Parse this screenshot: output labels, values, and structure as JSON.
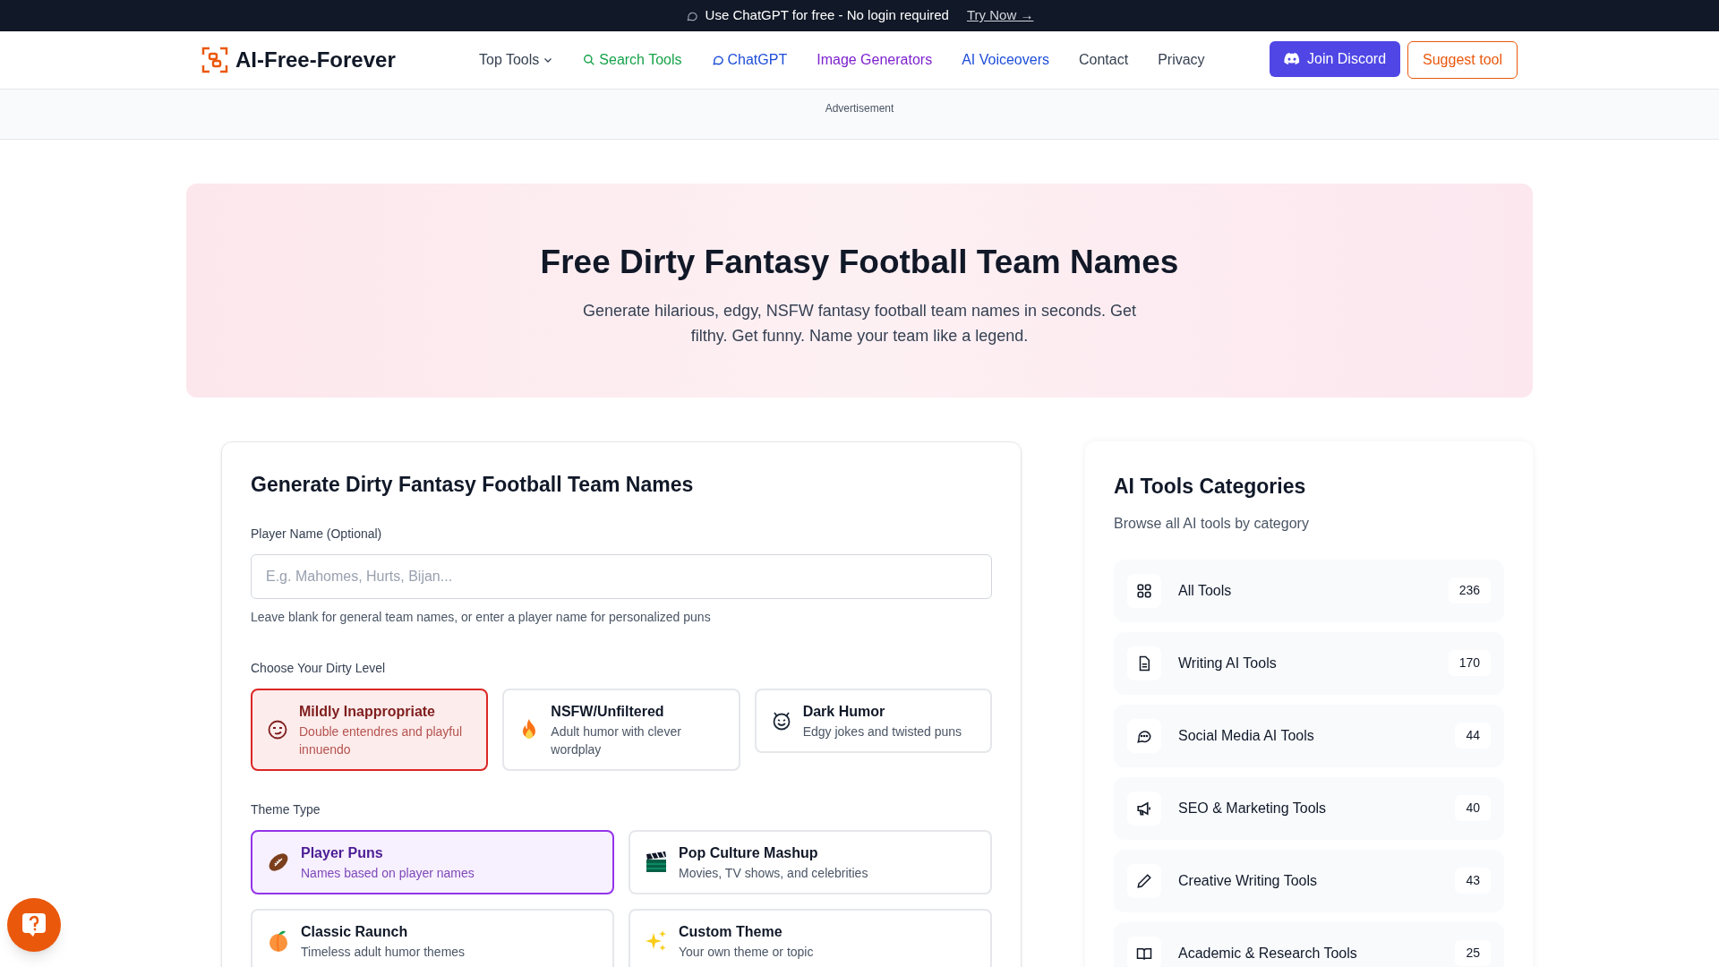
{
  "banner": {
    "text": "Use ChatGPT for free - No login required",
    "link": "Try Now →"
  },
  "nav": {
    "logo": "AI-Free-Forever",
    "items": [
      {
        "label": "Top Tools",
        "kind": "dropdown",
        "color": "#374151"
      },
      {
        "label": "Search Tools",
        "kind": "search",
        "color": "#16a34a"
      },
      {
        "label": "ChatGPT",
        "kind": "chat",
        "color": "#1d4ed8"
      },
      {
        "label": "Image Generators",
        "kind": "plain",
        "color": "#7e22ce"
      },
      {
        "label": "AI Voiceovers",
        "kind": "plain",
        "color": "#1d4ed8"
      },
      {
        "label": "Contact",
        "kind": "plain",
        "color": "#374151"
      },
      {
        "label": "Privacy",
        "kind": "plain",
        "color": "#374151"
      }
    ],
    "discord_button": "Join Discord",
    "suggest_button": "Suggest tool"
  },
  "ad_label": "Advertisement",
  "hero": {
    "title": "Free Dirty Fantasy Football Team Names",
    "subtitle": "Generate hilarious, edgy, NSFW fantasy football team names in seconds. Get filthy. Get funny. Name your team like a legend."
  },
  "generator": {
    "title": "Generate Dirty Fantasy Football Team Names",
    "player_field": {
      "label": "Player Name (Optional)",
      "placeholder": "E.g. Mahomes, Hurts, Bijan...",
      "hint": "Leave blank for general team names, or enter a player name for personalized puns"
    },
    "dirty_level": {
      "label": "Choose Your Dirty Level",
      "options": [
        {
          "title": "Mildly Inappropriate",
          "desc": "Double entendres and playful innuendo",
          "kind": "smirk",
          "selected": true
        },
        {
          "title": "NSFW/Unfiltered",
          "desc": "Adult humor with clever wordplay",
          "kind": "flame",
          "selected": false
        },
        {
          "title": "Dark Humor",
          "desc": "Edgy jokes and twisted puns",
          "kind": "devil",
          "selected": false
        }
      ]
    },
    "theme_type": {
      "label": "Theme Type",
      "options": [
        {
          "title": "Player Puns",
          "desc": "Names based on player names",
          "kind": "football",
          "selected": true
        },
        {
          "title": "Pop Culture Mashup",
          "desc": "Movies, TV shows, and celebrities",
          "kind": "clapper",
          "selected": false
        },
        {
          "title": "Classic Raunch",
          "desc": "Timeless adult humor themes",
          "kind": "peach",
          "selected": false
        },
        {
          "title": "Custom Theme",
          "desc": "Your own theme or topic",
          "kind": "sparkles",
          "selected": false
        }
      ]
    }
  },
  "categories": {
    "title": "AI Tools Categories",
    "subtitle": "Browse all AI tools by category",
    "items": [
      {
        "label": "All Tools",
        "count": "236",
        "kind": "grid"
      },
      {
        "label": "Writing AI Tools",
        "count": "170",
        "kind": "document"
      },
      {
        "label": "Social Media AI Tools",
        "count": "44",
        "kind": "chat"
      },
      {
        "label": "SEO & Marketing Tools",
        "count": "40",
        "kind": "megaphone"
      },
      {
        "label": "Creative Writing Tools",
        "count": "43",
        "kind": "pencil"
      },
      {
        "label": "Academic & Research Tools",
        "count": "25",
        "kind": "book"
      }
    ]
  }
}
